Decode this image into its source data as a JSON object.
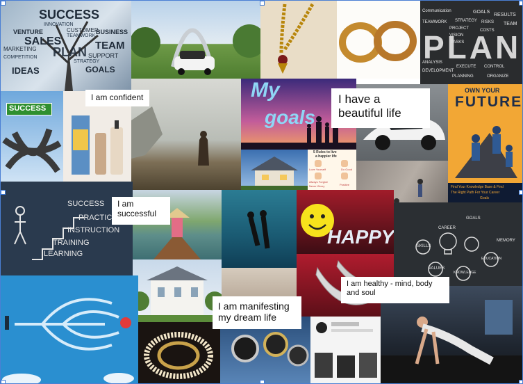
{
  "cloud_words": {
    "success": "SUCCESS",
    "innovation": "INNOVATION",
    "venture": "VENTURE",
    "customer": "CUSTOMER",
    "business": "BUSINESS",
    "sales": "SALES",
    "teamwork": "TEAMWORK",
    "marketing": "MARKETING",
    "team": "TEAM",
    "plan": "PLAN",
    "competition": "COMPETITION",
    "support": "SUPPORT",
    "ideas": "IDEAS",
    "strategy": "STRATEGY",
    "goals": "GOALS"
  },
  "plan_board": {
    "big": "PLAN",
    "words": [
      "Communication",
      "GOALS",
      "RESULTS",
      "TEAMWORK",
      "STRATEGY",
      "RISKS",
      "TEAM",
      "PROJECT",
      "COSTS",
      "VISION",
      "TASKS",
      "ANALYSIS",
      "EXECUTE",
      "CONTROL",
      "DEVELOPMENT",
      "PLANNING",
      "ORGANIZE"
    ]
  },
  "sign": {
    "success": "SUCCESS"
  },
  "my_goals": {
    "line1": "My",
    "line2": "goals"
  },
  "future_book": {
    "top": "OWN YOUR",
    "title": "FUTURE",
    "footer1": "Find Your Knowledge Base & Find",
    "footer2": "The Right Path For Your Career",
    "footer3": "Goals"
  },
  "rules": {
    "title1": "5 Rules to live",
    "title2": "a happier life",
    "r1": "Love Yourself",
    "r2": "Do Good",
    "r3": "Always Forgive",
    "r4": "Never Worry",
    "r5": "Positive"
  },
  "stairs": {
    "s1": "SUCCESS",
    "s2": "PRACTICE",
    "s3": "INSTRUCTION",
    "s4": "TRAINING",
    "s5": "LEARNING"
  },
  "bulbs": {
    "w1": "CAREER",
    "w2": "GOALS",
    "w3": "SKILLS",
    "w4": "VALUES",
    "w5": "KNOWLEDGE",
    "w6": "EDUCATION",
    "w7": "MEMORY"
  },
  "happy": "HAPPY",
  "affirmations": {
    "a1": "I am confident",
    "a2": "I have a beautiful life",
    "a3": "I am successful",
    "a4": "I am manifesting my dream life",
    "a5": "I am healthy - mind, body and soul"
  },
  "colors": {
    "accent": "#3a78d6",
    "maze_bg": "#2a8fd0",
    "chalkboard": "#2b2f33"
  }
}
